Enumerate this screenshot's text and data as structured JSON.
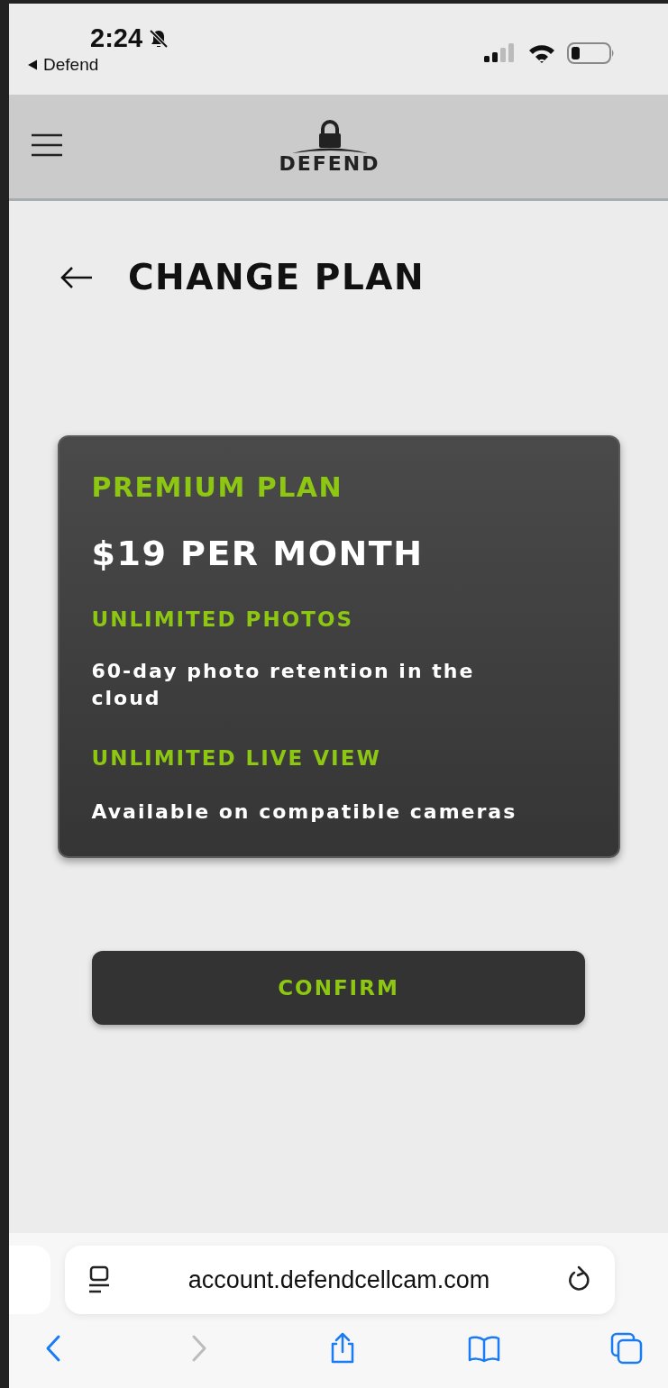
{
  "status_bar": {
    "time": "2:24",
    "back_app": "Defend",
    "silent": true
  },
  "header": {
    "logo": "DEFEND"
  },
  "page": {
    "title": "CHANGE PLAN"
  },
  "plan": {
    "name": "PREMIUM PLAN",
    "price": "$19 PER MONTH",
    "features": [
      {
        "title": "UNLIMITED PHOTOS",
        "detail": "60-day photo retention in the cloud"
      },
      {
        "title": "UNLIMITED LIVE VIEW",
        "detail": "Available on compatible cameras"
      }
    ]
  },
  "confirm_button": "CONFIRM",
  "browser": {
    "url": "account.defendcellcam.com",
    "toolbar": [
      {
        "kind": "back",
        "disabled": false
      },
      {
        "kind": "forward",
        "disabled": true
      },
      {
        "kind": "share",
        "disabled": false
      },
      {
        "kind": "bookmarks",
        "disabled": false
      },
      {
        "kind": "tabs",
        "disabled": false
      }
    ]
  }
}
